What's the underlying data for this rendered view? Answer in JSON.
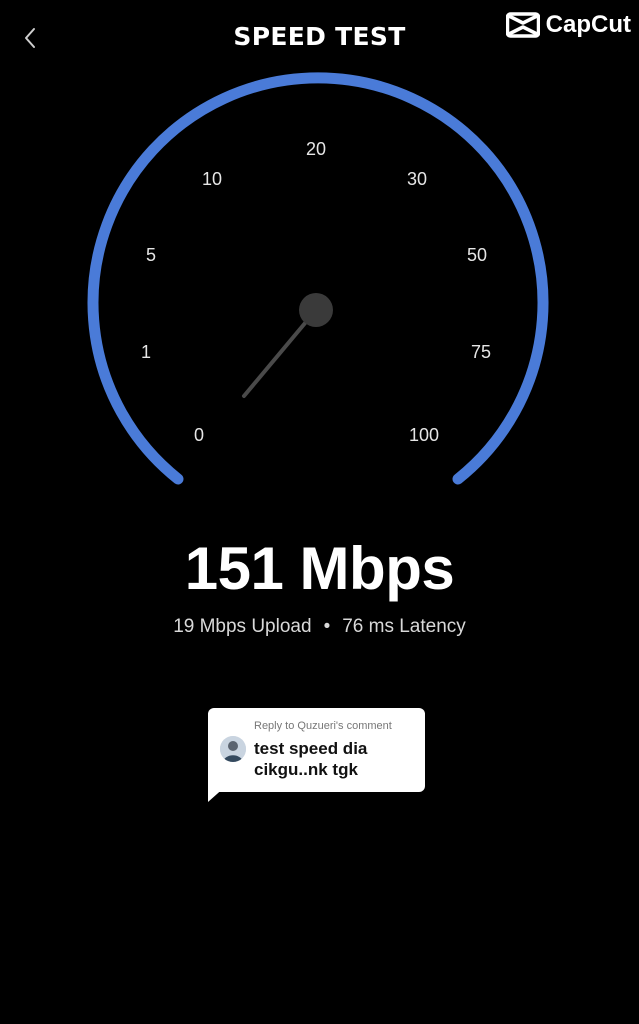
{
  "header": {
    "title": "SPEED TEST",
    "back_icon": "chevron-left-icon",
    "brand": "CapCut",
    "brand_icon": "capcut-logo-icon"
  },
  "gauge": {
    "labels": [
      "0",
      "1",
      "5",
      "10",
      "20",
      "30",
      "50",
      "75",
      "100"
    ],
    "arc_color": "#4A7BD8",
    "needle_color": "#4a4a4a"
  },
  "result": {
    "download_text": "151 Mbps",
    "upload_text": "19 Mbps Upload",
    "separator": "•",
    "latency_text": "76 ms Latency"
  },
  "reply": {
    "meta": "Reply to Quzueri's comment",
    "text": "test speed dia cikgu..nk tgk"
  }
}
